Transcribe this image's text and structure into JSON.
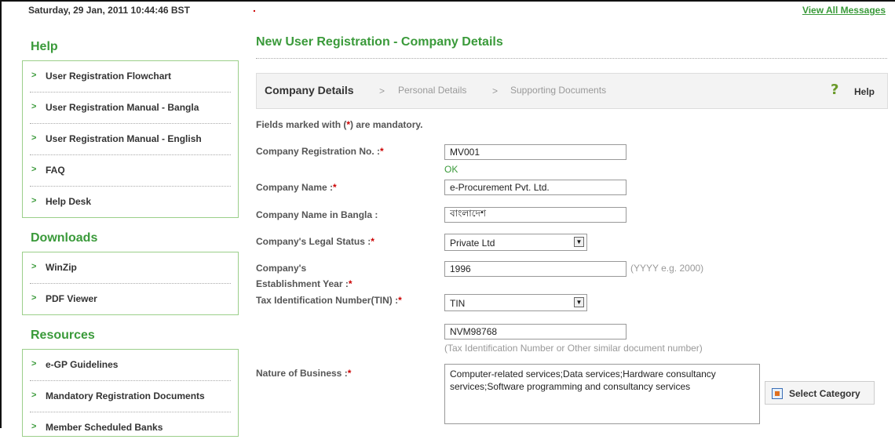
{
  "header": {
    "datetime": "Saturday, 29 Jan, 2011 10:44:46 BST",
    "dot": ".",
    "view_all_messages": "View All Messages"
  },
  "sidebar": {
    "help": {
      "title": "Help",
      "items": [
        "User Registration Flowchart",
        "User Registration Manual - Bangla",
        "User Registration Manual - English",
        "FAQ",
        "Help Desk"
      ]
    },
    "downloads": {
      "title": "Downloads",
      "items": [
        "WinZip",
        "PDF Viewer"
      ]
    },
    "resources": {
      "title": "Resources",
      "items": [
        "e-GP Guidelines",
        "Mandatory Registration Documents",
        "Member Scheduled Banks"
      ]
    }
  },
  "main": {
    "title": "New User Registration - Company Details",
    "steps": {
      "active": "Company Details",
      "sep": ">",
      "step2": "Personal Details",
      "step3": "Supporting Documents",
      "help_label": "Help"
    },
    "mandatory_note": {
      "prefix": "Fields marked with (",
      "star": "*",
      "suffix": ") are mandatory."
    },
    "req_mark": "*",
    "fields": {
      "reg_no": {
        "label": "Company Registration No. :",
        "value": "MV001",
        "status": "OK"
      },
      "name": {
        "label": "Company Name :",
        "value": "e-Procurement Pvt. Ltd."
      },
      "name_bangla": {
        "label": "Company Name in Bangla :",
        "value": "বাংলাদেশ"
      },
      "legal_status": {
        "label": "Company's Legal Status :",
        "value": "Private Ltd"
      },
      "est_year": {
        "label_line1": "Company's",
        "label_line2": "Establishment Year :",
        "value": "1996",
        "hint": "(YYYY e.g. 2000)"
      },
      "tin": {
        "label": "Tax Identification Number(TIN) :",
        "type_value": "TIN",
        "number_value": "NVM98768",
        "hint": "(Tax Identification Number or Other similar document number)"
      },
      "business": {
        "label": "Nature of Business :",
        "value": "Computer-related services;Data services;Hardware consultancy services;Software programming and consultancy services",
        "button_label": "Select Category"
      }
    }
  }
}
